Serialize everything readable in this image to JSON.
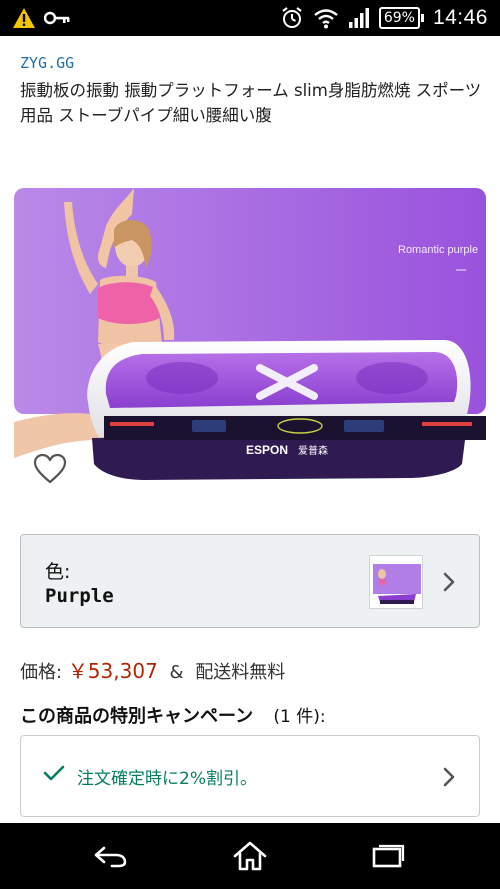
{
  "status_bar": {
    "warning_icon": "warning-triangle-icon",
    "key_icon": "vpn-key-icon",
    "alarm_icon": "alarm-clock-icon",
    "wifi_icon": "wifi-icon",
    "signal_icon": "cell-signal-icon",
    "battery_percent": "69%",
    "time": "14:46"
  },
  "product": {
    "brand": "ZYG.GG",
    "title": "振動板の振動 振動プラットフォーム slim身脂肪燃焼 スポーツ用品 ストーブパイプ細い腰細い腹",
    "image_caption": "Romantic purple",
    "device_brand": "ESPON",
    "device_brand_suffix": "爱普森"
  },
  "color_selector": {
    "label": "色:",
    "value": "Purple"
  },
  "price": {
    "label": "価格:",
    "amount": "￥53,307",
    "amp": "&",
    "shipping": "配送料無料"
  },
  "campaign": {
    "title": "この商品の特別キャンペーン",
    "count": "(1 件):",
    "offer": "注文確定時に2%割引。"
  },
  "colors": {
    "accent_price": "#b12704",
    "brand_link": "#1f6ea8",
    "offer_green": "#067d62",
    "hero_purple": "#a45ee0"
  },
  "nav_bar": {
    "back_icon": "back-icon",
    "home_icon": "home-icon",
    "recents_icon": "recent-apps-icon"
  }
}
